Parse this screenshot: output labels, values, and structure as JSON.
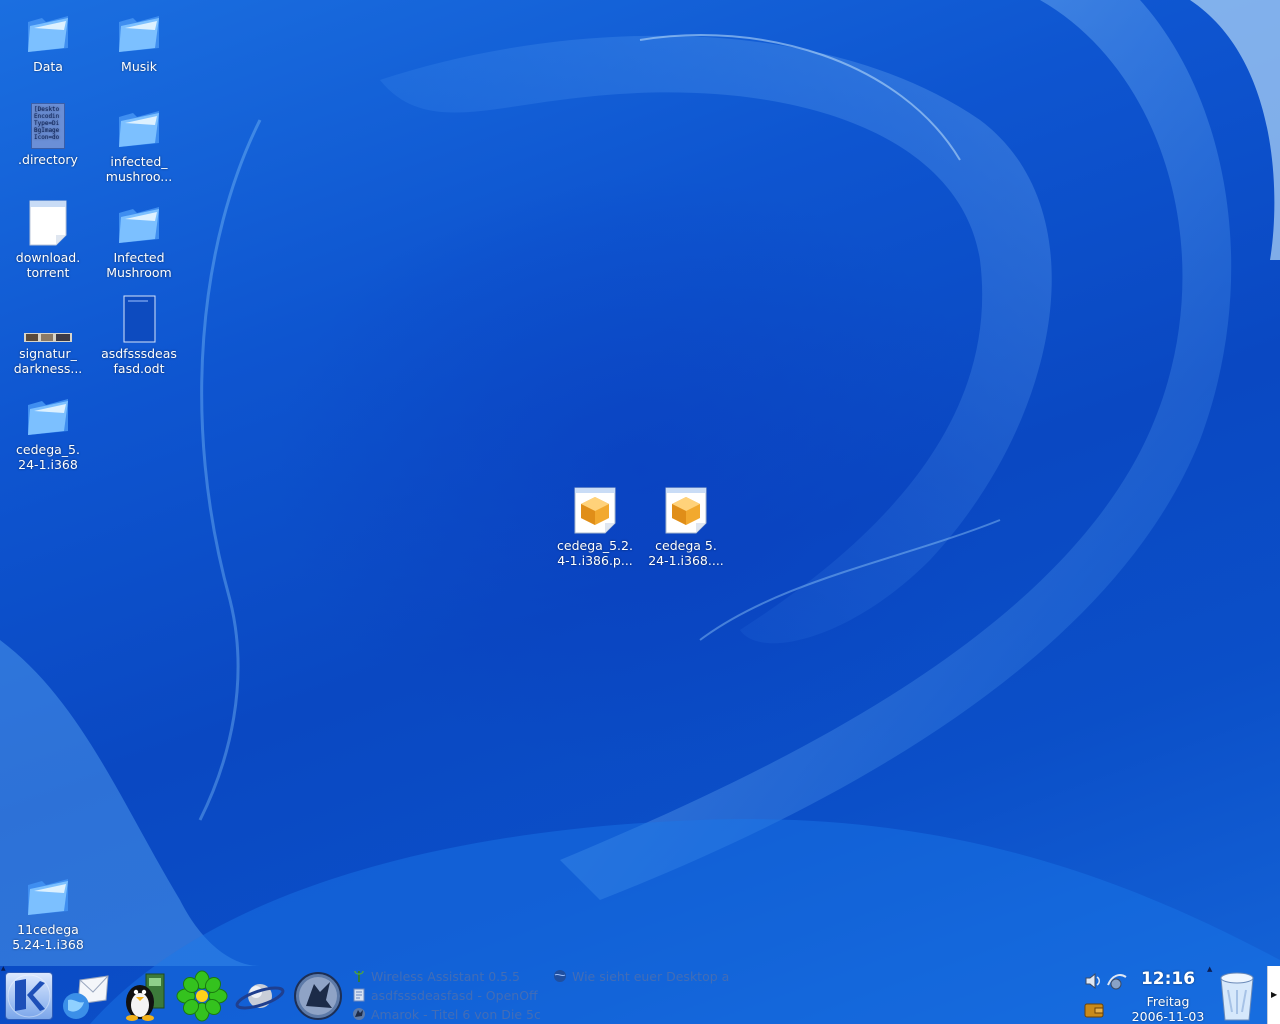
{
  "desktop_icons": [
    {
      "label": "Data",
      "icon": "folder-icon"
    },
    {
      "label": "Musik",
      "icon": "folder-icon"
    },
    {
      "label": ".directory",
      "icon": "text-file-icon"
    },
    {
      "label": "infected_\nmushroo...",
      "icon": "folder-icon"
    },
    {
      "label": "download.\ntorrent",
      "icon": "blank-file-icon"
    },
    {
      "label": "Infected\nMushroom",
      "icon": "folder-icon"
    },
    {
      "label": "signatur_\ndarkness...",
      "icon": "image-thumbnail-icon"
    },
    {
      "label": "asdfsssdeas\nfasd.odt",
      "icon": "document-icon"
    },
    {
      "label": "cedega_5.\n24-1.i368",
      "icon": "folder-icon"
    },
    {
      "label": "cedega_5.2.\n4-1.i386.p...",
      "icon": "package-icon"
    },
    {
      "label": "cedega 5.\n24-1.i368....",
      "icon": "package-icon"
    },
    {
      "label": "11cedega\n5.24-1.i368",
      "icon": "folder-icon"
    }
  ],
  "directory_preview_text": "[Deskto\nEncodin\nType=Di\nBgImage\nIcon=do",
  "taskbar": {
    "launchers": [
      {
        "name": "kde-menu-icon"
      },
      {
        "name": "mail-browser-icon"
      },
      {
        "name": "linux-penguin-icon"
      },
      {
        "name": "icq-flower-icon"
      },
      {
        "name": "planet-browser-icon"
      },
      {
        "name": "amarok-wolf-icon"
      }
    ],
    "tasks": [
      {
        "label": "Wireless Assistant 0.5.5",
        "icon": "antenna-icon"
      },
      {
        "label": "Wie sieht euer Desktop a",
        "icon": "globe-icon"
      },
      {
        "label": "asdfsssdeasfasd - OpenOff",
        "icon": "writer-icon"
      },
      {
        "label": "Amarok - Titel 6 von Die 5c",
        "icon": "amarok-icon"
      }
    ],
    "clock": {
      "time": "12:16",
      "day": "Freitag",
      "date": "2006-11-03"
    }
  },
  "colors": {
    "desktop_blue": "#0e55d0",
    "label_text": "#ffffff",
    "task_text": "#466eb4"
  }
}
